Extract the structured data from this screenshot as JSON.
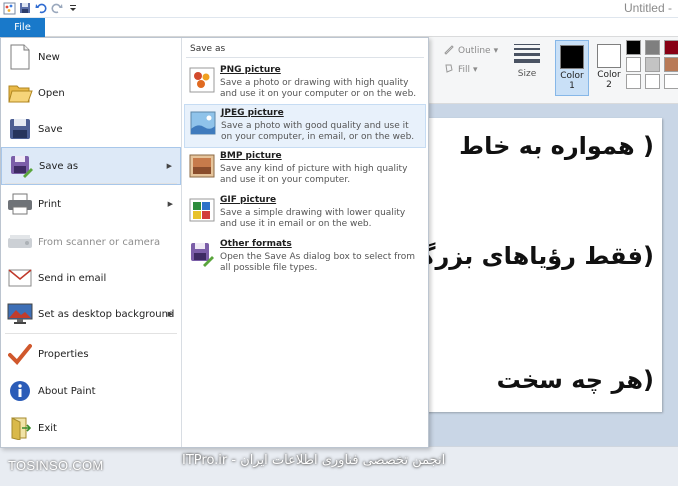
{
  "window": {
    "title": "Untitled -"
  },
  "ribbon": {
    "file_tab": "File",
    "outline_label": "Outline",
    "fill_label": "Fill",
    "size_label": "Size",
    "color1_label": "Color\n1",
    "color2_label": "Color\n2",
    "palette": [
      "#000000",
      "#7f7f7f",
      "#880015",
      "#ed1c24",
      "#ffffff",
      "#c3c3c3",
      "#b97a57",
      "#ffaec9",
      "#ffffff",
      "#ffffff",
      "#ffffff",
      "#ffffff"
    ]
  },
  "file_menu": {
    "items": [
      {
        "label": "New",
        "icon": "new-document-icon",
        "has_arrow": false,
        "disabled": false
      },
      {
        "label": "Open",
        "icon": "open-folder-icon",
        "has_arrow": false,
        "disabled": false
      },
      {
        "label": "Save",
        "icon": "floppy-disk-icon",
        "has_arrow": false,
        "disabled": false
      },
      {
        "label": "Save as",
        "icon": "save-as-icon",
        "has_arrow": true,
        "disabled": false
      },
      {
        "label": "Print",
        "icon": "printer-icon",
        "has_arrow": true,
        "disabled": false
      },
      {
        "label": "From scanner or camera",
        "icon": "scanner-icon",
        "has_arrow": false,
        "disabled": true
      },
      {
        "label": "Send in email",
        "icon": "email-icon",
        "has_arrow": false,
        "disabled": false
      },
      {
        "label": "Set as desktop background",
        "icon": "desktop-background-icon",
        "has_arrow": true,
        "disabled": false
      },
      {
        "label": "Properties",
        "icon": "checkmark-icon",
        "has_arrow": false,
        "disabled": false
      },
      {
        "label": "About Paint",
        "icon": "info-icon",
        "has_arrow": false,
        "disabled": false
      },
      {
        "label": "Exit",
        "icon": "exit-icon",
        "has_arrow": false,
        "disabled": false
      }
    ],
    "selected": "Save as"
  },
  "save_as_menu": {
    "header": "Save as",
    "items": [
      {
        "title": "PNG picture",
        "description": "Save a photo or drawing with high quality and use it on your computer or on the web.",
        "icon": "png-picture-icon"
      },
      {
        "title": "JPEG picture",
        "description": "Save a photo with good quality and use it on your computer, in email, or on the web.",
        "icon": "jpeg-picture-icon"
      },
      {
        "title": "BMP picture",
        "description": "Save any kind of picture with high quality and use it on your computer.",
        "icon": "bmp-picture-icon"
      },
      {
        "title": "GIF picture",
        "description": "Save a simple drawing with lower quality and use it in email or on the web.",
        "icon": "gif-picture-icon"
      },
      {
        "title": "Other formats",
        "description": "Open the Save As dialog box to select from all possible file types.",
        "icon": "other-formats-icon"
      }
    ],
    "hovered": "JPEG picture"
  },
  "canvas": {
    "lines": [
      "( همواره به خاط",
      "(فقط رؤیاهای بزرگ م",
      "(هر چه سخت"
    ]
  },
  "watermarks": {
    "left": "TOSINSO.COM",
    "middle": "انجمن تخصصی فناوری اطلاعات ایران - ITPro.ir"
  }
}
